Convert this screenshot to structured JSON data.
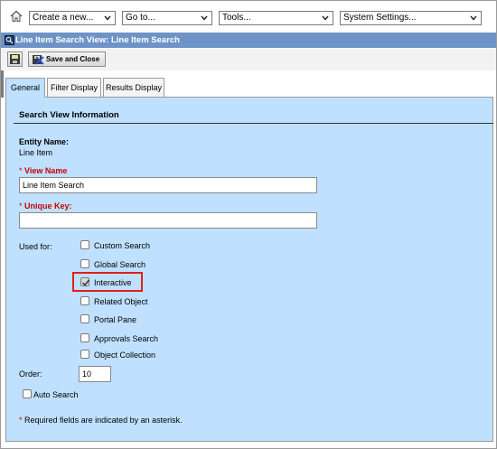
{
  "topbar": {
    "home_icon": "home-icon",
    "create_new": "Create a new...",
    "go_to": "Go to...",
    "tools": "Tools...",
    "system_settings": "System Settings..."
  },
  "titlebar": {
    "title": "Line Item Search View: Line Item Search"
  },
  "toolbar": {
    "save_close_label": "Save and Close"
  },
  "tabs": [
    {
      "label": "General",
      "active": true
    },
    {
      "label": "Filter Display",
      "active": false
    },
    {
      "label": "Results Display",
      "active": false
    }
  ],
  "form": {
    "section_title": "Search View Information",
    "entity_name_label": "Entity Name:",
    "entity_name_value": "Line Item",
    "required_marker": "*",
    "view_name_label": "View Name",
    "view_name_value": "Line Item Search",
    "unique_key_label": "Unique Key:",
    "unique_key_value": "",
    "used_for_label": "Used for:",
    "used_for_options": [
      {
        "label": "Custom Search",
        "checked": false
      },
      {
        "label": "Global Search",
        "checked": false
      },
      {
        "label": "Interactive",
        "checked": true
      },
      {
        "label": "Related Object",
        "checked": false
      },
      {
        "label": "Portal Pane",
        "checked": false
      },
      {
        "label": "Approvals Search",
        "checked": false
      },
      {
        "label": "Object Collection",
        "checked": false
      }
    ],
    "order_label": "Order:",
    "order_value": "10",
    "auto_search_label": "Auto Search",
    "auto_search_checked": false,
    "required_note": "Required fields are indicated by an asterisk."
  },
  "colors": {
    "title_bar": "#6e93c8",
    "panel": "#bfe0ff",
    "required": "#cc0000",
    "highlight": "#e0201b"
  }
}
